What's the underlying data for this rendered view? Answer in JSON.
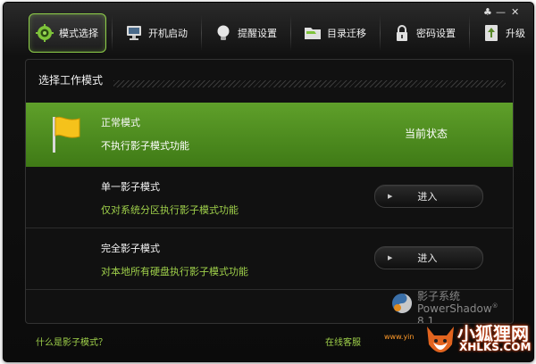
{
  "window": {
    "controls": {
      "menu": "♣",
      "minimize": "—",
      "close": "✕"
    }
  },
  "toolbar": {
    "tabs": [
      {
        "label": "模式选择",
        "icon": "gear-icon",
        "active": true
      },
      {
        "label": "开机启动",
        "icon": "monitor-icon",
        "active": false
      },
      {
        "label": "提醒设置",
        "icon": "bulb-icon",
        "active": false
      },
      {
        "label": "目录迁移",
        "icon": "folder-icon",
        "active": false
      },
      {
        "label": "密码设置",
        "icon": "lock-icon",
        "active": false
      },
      {
        "label": "升级",
        "icon": "upgrade-icon",
        "active": false
      }
    ]
  },
  "panel": {
    "title": "选择工作模式",
    "modes": [
      {
        "name": "正常模式",
        "desc": "不执行影子模式功能",
        "status": "当前状态"
      },
      {
        "name": "单一影子模式",
        "desc": "仅对系统分区执行影子模式功能",
        "button": "进入"
      },
      {
        "name": "完全影子模式",
        "desc": "对本地所有硬盘执行影子模式功能",
        "button": "进入"
      }
    ]
  },
  "logo": {
    "name_cn": "影子系统",
    "name_en": "PowerShadow",
    "version": "8.1"
  },
  "footer": {
    "help_link": "什么是影子模式？",
    "support_link": "在线客服",
    "site_partial": "www.yin"
  },
  "watermark": {
    "cn": "小狐狸网",
    "en": "XHLKS.COM"
  },
  "colors": {
    "accent": "#5fa02a",
    "link": "#9fd04a",
    "panel": "#111111"
  }
}
